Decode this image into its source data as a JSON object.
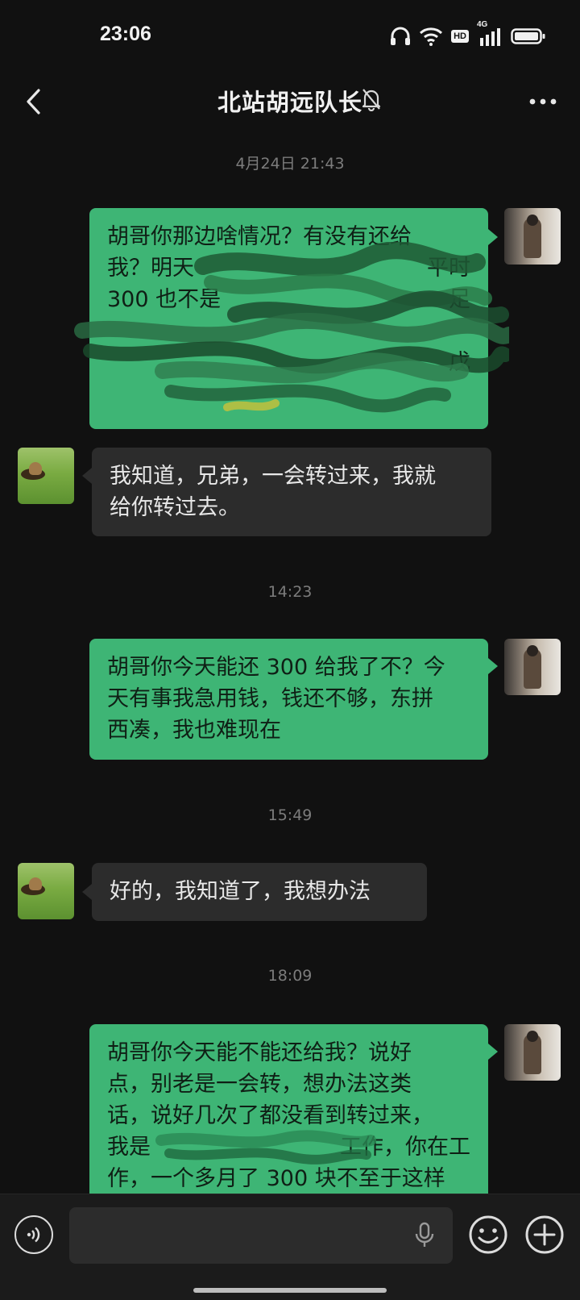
{
  "status_bar": {
    "time": "23:06",
    "hd_label": "HD",
    "network_label": "4G"
  },
  "header": {
    "title": "北站胡远队长"
  },
  "timestamps": [
    "4月24日 21:43",
    "14:23",
    "15:49",
    "18:09"
  ],
  "messages": [
    {
      "sender": "me",
      "lines": [
        "胡哥你那边啥情况？有没有还给",
        "我？明天",
        "300 也不是",
        "",
        "",
        ""
      ]
    },
    {
      "sender": "them",
      "lines": [
        "我知道，兄弟，一会转过来，我就",
        "给你转过去。"
      ]
    },
    {
      "sender": "me",
      "lines": [
        "胡哥你今天能还 300 给我了不？今",
        "天有事我急用钱，钱还不够，东拼",
        "西凑，我也难现在"
      ]
    },
    {
      "sender": "them",
      "lines": [
        "好的，我知道了，我想办法"
      ]
    },
    {
      "sender": "me",
      "lines": [
        "胡哥你今天能不能还给我？说好",
        "点，别老是一会转，想办法这类",
        "话，说好几次了都没看到转过来，",
        "我是",
        "作，一个多月了 300 块不至于这样"
      ]
    }
  ],
  "message1_tail_chars": [
    "平时",
    "足",
    "戊"
  ],
  "message5_tail_chars": [
    "工作，你在工"
  ],
  "input": {
    "placeholder": ""
  },
  "colors": {
    "bubble_me": "#3eb575",
    "bubble_them": "#2c2c2c",
    "background": "#111111"
  },
  "icons": [
    "headphones-icon",
    "wifi-icon",
    "signal-icon",
    "battery-icon",
    "back-icon",
    "mute-bell-icon",
    "more-icon",
    "voice-icon",
    "microphone-icon",
    "emoji-icon",
    "plus-icon"
  ]
}
